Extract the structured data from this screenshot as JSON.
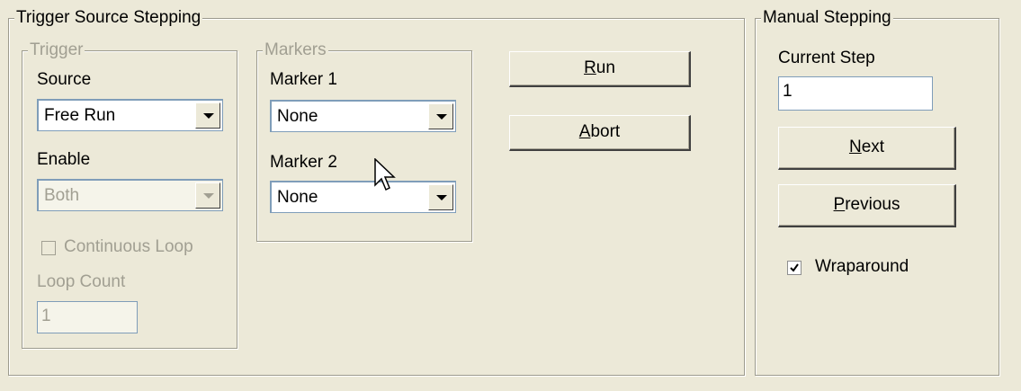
{
  "trigger_source_stepping": {
    "title": "Trigger Source Stepping",
    "trigger": {
      "title": "Trigger",
      "source_label": "Source",
      "source_value": "Free Run",
      "enable_label": "Enable",
      "enable_value": "Both",
      "continuous_loop_label": "Continuous Loop",
      "loop_count_label": "Loop Count",
      "loop_count_value": "1"
    },
    "markers": {
      "title": "Markers",
      "marker1_label": "Marker 1",
      "marker1_value": "None",
      "marker2_label": "Marker 2",
      "marker2_value": "None"
    },
    "run_button": {
      "mnemonic": "R",
      "rest": "un"
    },
    "abort_button": {
      "mnemonic": "A",
      "rest": "bort"
    }
  },
  "manual_stepping": {
    "title": "Manual Stepping",
    "current_step_label": "Current Step",
    "current_step_value": "1",
    "next_button": {
      "mnemonic": "N",
      "rest": "ext"
    },
    "previous_button": {
      "mnemonic": "P",
      "rest": "revious"
    },
    "wraparound_label": "Wraparound",
    "wraparound_checked": true
  }
}
